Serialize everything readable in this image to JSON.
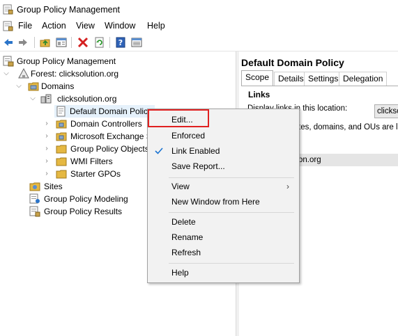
{
  "window": {
    "title": "Group Policy Management"
  },
  "menubar": [
    "File",
    "Action",
    "View",
    "Window",
    "Help"
  ],
  "toolbar": {
    "icons": [
      "back-arrow-icon",
      "forward-arrow-icon",
      "up-folder-icon",
      "show-hide-tree-icon",
      "delete-x-icon",
      "refresh-icon",
      "help-icon",
      "properties-icon"
    ]
  },
  "tree": {
    "root": "Group Policy Management",
    "forest": "Forest: clicksolution.org",
    "domains": "Domains",
    "domain": "clicksolution.org",
    "items": [
      "Default Domain Polic",
      "Domain Controllers",
      "Microsoft Exchange S",
      "Group Policy Objects",
      "WMI Filters",
      "Starter GPOs"
    ],
    "sites": "Sites",
    "modeling": "Group Policy Modeling",
    "results": "Group Policy Results"
  },
  "right": {
    "title": "Default Domain Policy",
    "tabs": [
      "Scope",
      "Details",
      "Settings",
      "Delegation"
    ],
    "links_heading": "Links",
    "display_label": "Display links in this location:",
    "combo_value": "clicksc",
    "text_partial": "tes, domains, and OUs are link",
    "row_partial": "on.org"
  },
  "context_menu": {
    "items": [
      "Edit...",
      "Enforced",
      "Link Enabled",
      "Save Report...",
      "View",
      "New Window from Here",
      "Delete",
      "Rename",
      "Refresh",
      "Help"
    ],
    "checked_item": "Link Enabled",
    "submenu_item": "View"
  },
  "colors": {
    "highlight": "#e02020",
    "check": "#1a73d1",
    "menu_bg": "#f2f2f2"
  }
}
